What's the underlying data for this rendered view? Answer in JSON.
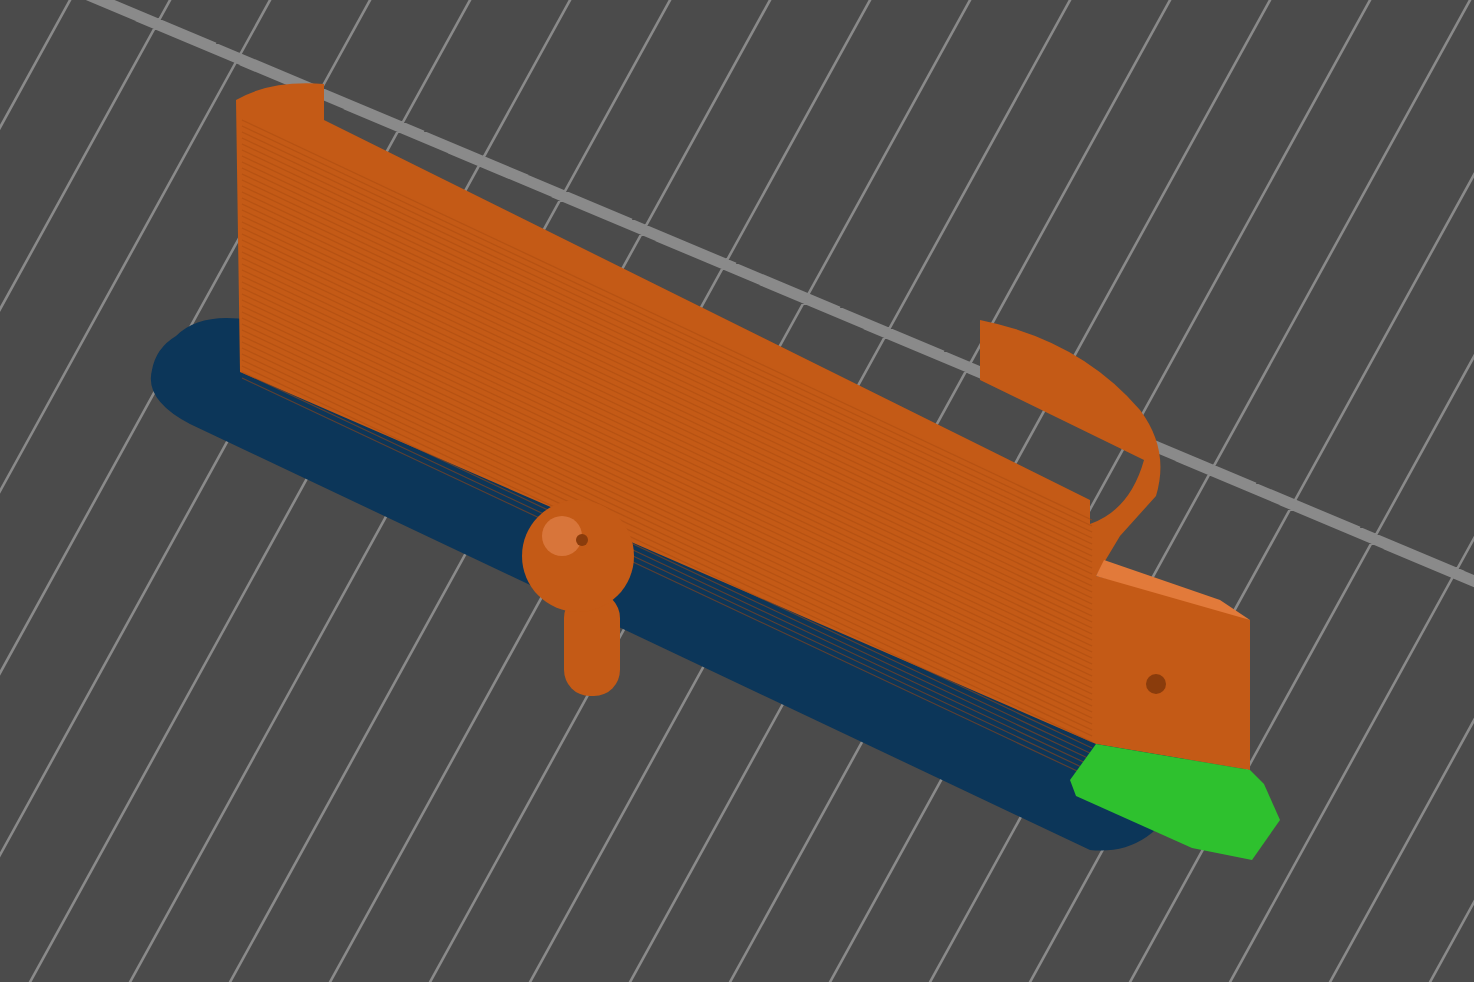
{
  "viewport": {
    "objects": [
      {
        "kind": "brim",
        "color": "#0c3659"
      },
      {
        "kind": "perimeter",
        "color": "#c45a16"
      },
      {
        "kind": "support",
        "color": "#2ec12e"
      }
    ]
  }
}
